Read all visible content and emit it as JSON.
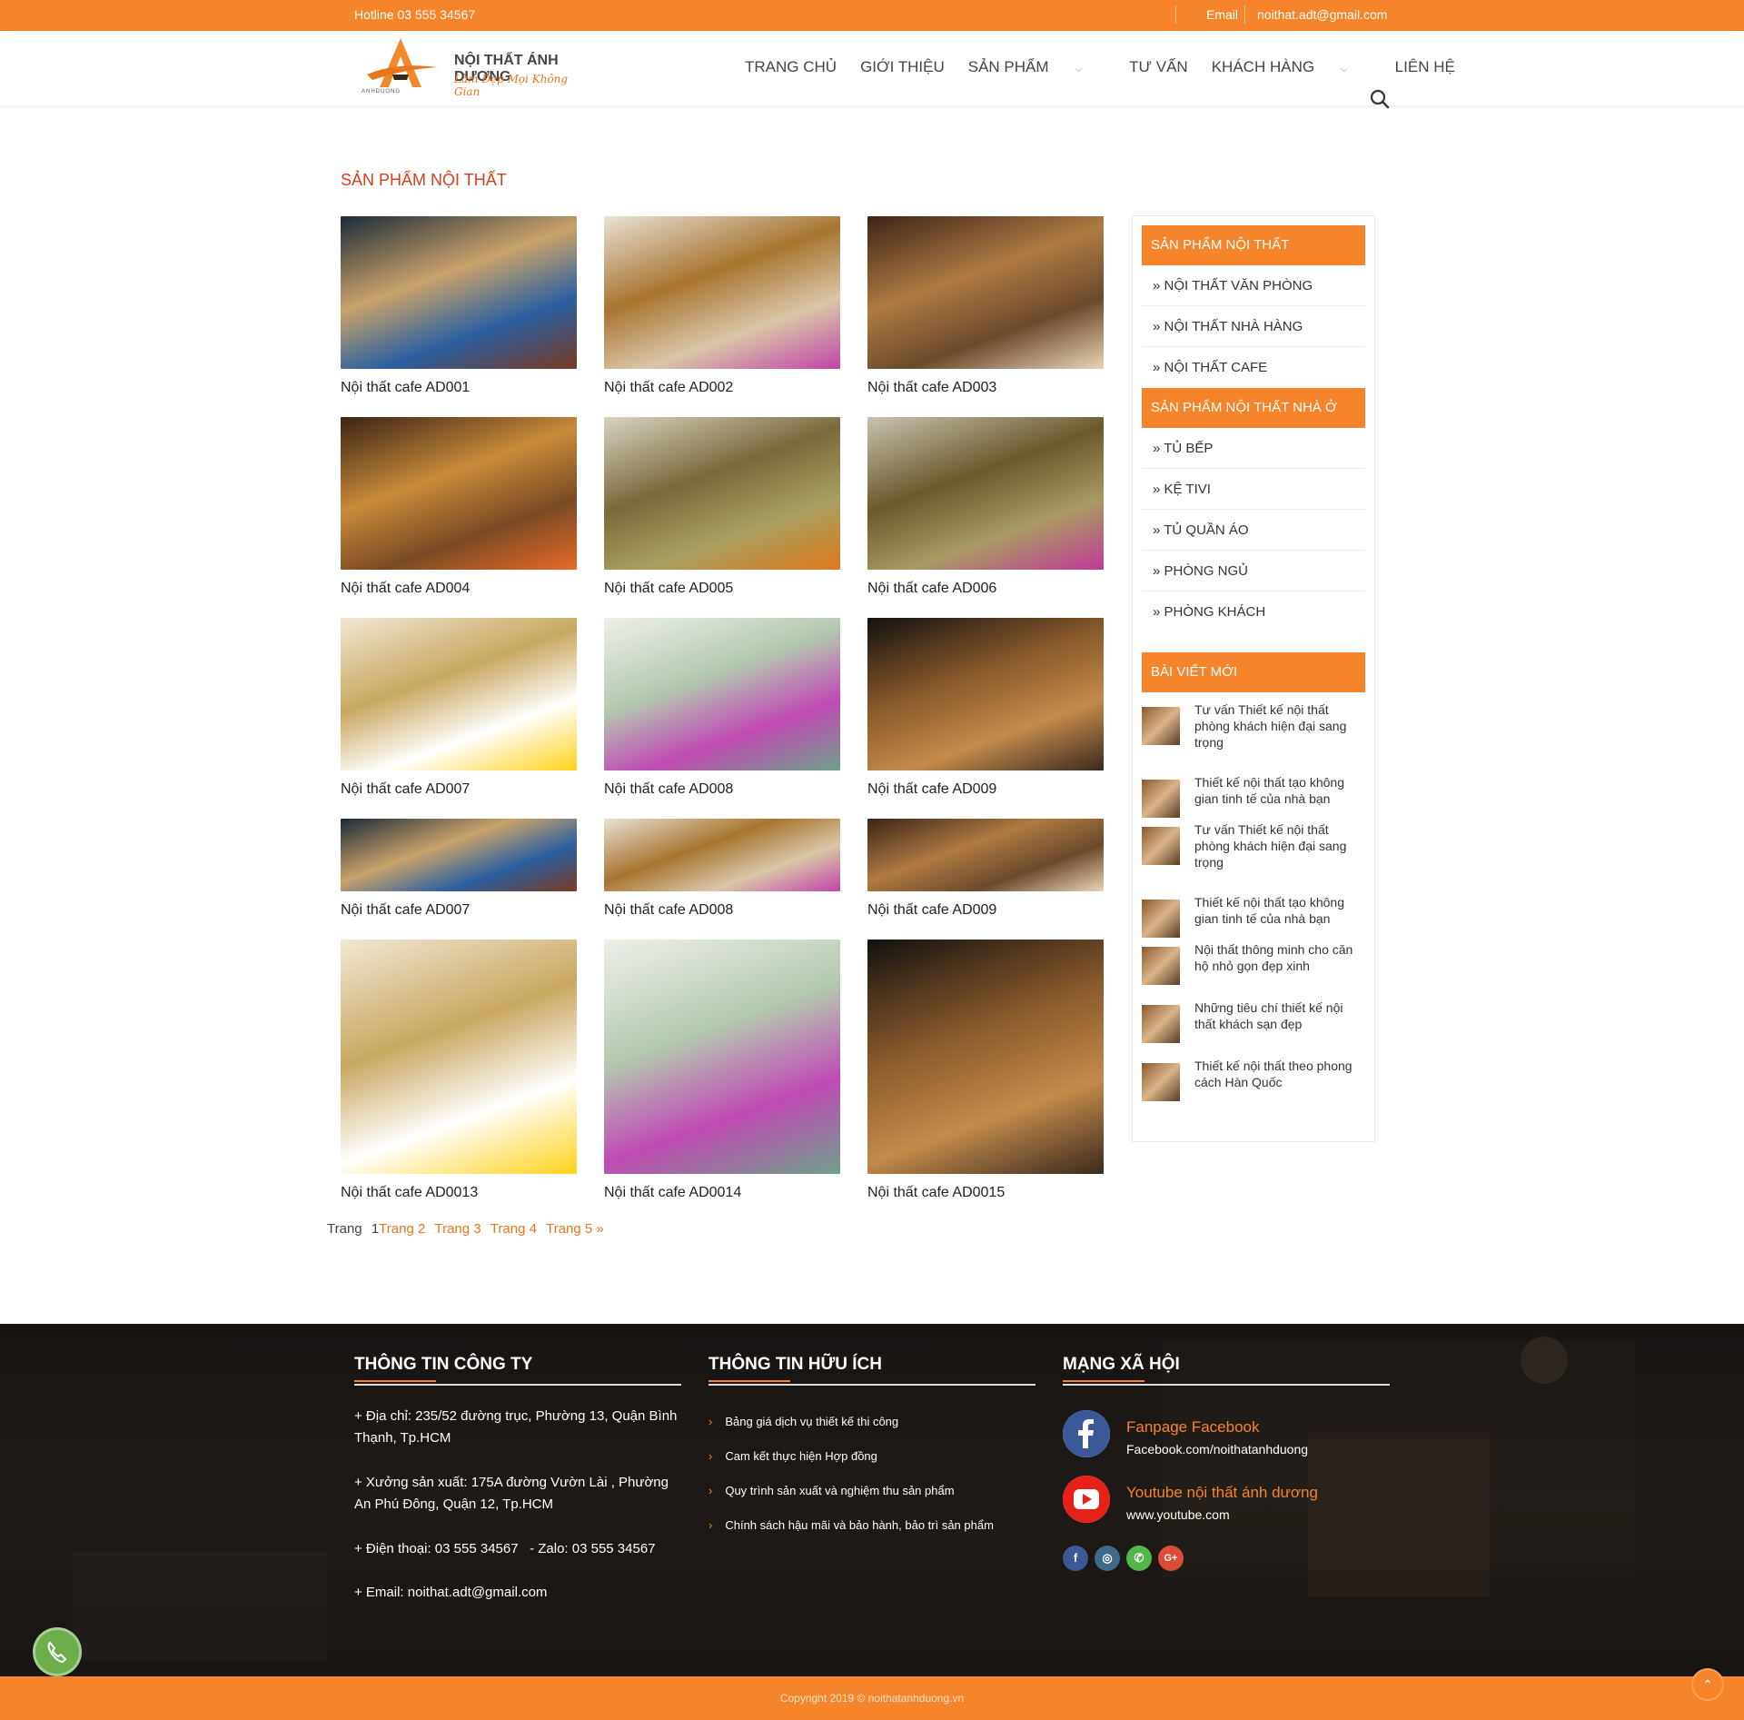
{
  "topbar": {
    "hotline": "Hotline 03 555 34567",
    "email_label": "Email",
    "email": "noithat.adt@gmail.com"
  },
  "logo": {
    "name": "NỘI THẤT ÁNH DƯƠNG",
    "tagline": "Làm Đẹp Mọi Không Gian",
    "sub": "ANHDUONG",
    "sub2": "LÀM ĐẸP MỌI KHÔNG GIAN"
  },
  "nav": {
    "items": [
      "TRANG CHỦ",
      "GIỚI THIỆU",
      "SẢN PHẨM",
      "TƯ VẤN",
      "KHÁCH HÀNG",
      "LIÊN HỆ"
    ],
    "caret": "⌵"
  },
  "page_title": "SẢN PHẨM NỘI THẤT",
  "products": [
    "Nội thất cafe AD001",
    "Nội thất cafe AD002",
    "Nội thất cafe AD003",
    "Nội thất cafe AD004",
    "Nội thất cafe AD005",
    "Nội thất cafe AD006",
    "Nội thất cafe AD007",
    "Nội thất cafe AD008",
    "Nội thất cafe AD009",
    "Nội thất cafe AD007",
    "Nội thất cafe AD008",
    "Nội thất cafe AD009",
    "Nội thất cafe AD0013",
    "Nội thất cafe AD0014",
    "Nội thất cafe AD0015"
  ],
  "pager": {
    "label": "Trang",
    "current": "1",
    "links": [
      "Trang 2",
      "Trang 3",
      "Trang 4",
      "Trang 5 »"
    ]
  },
  "sidebar": {
    "head1": "SẢN PHẨM NỘI THẤT",
    "items1": [
      "» NỘI THẤT VĂN PHÒNG",
      "» NỘI THẤT NHÀ HÀNG",
      "» NỘI THẤT CAFE"
    ],
    "head2": "SẢN PHẨM NỘI THẤT NHÀ Ở",
    "items2": [
      "» TỦ BẾP",
      "» KỆ TIVI",
      "» TỦ QUẦN ÁO",
      "» PHÒNG NGỦ",
      "» PHÒNG KHÁCH"
    ],
    "head3": "BÀI VIẾT MỚI",
    "posts": [
      "Tư vấn Thiết kế nội thất phòng khách hiện đại sang trọng",
      "Thiết kế nội thất tạo không gian tinh tế của nhà bạn",
      "Tư vấn Thiết kế nội thất phòng khách hiện đại sang trọng",
      "Thiết kế nội thất tạo không gian tinh tế của nhà bạn",
      "Nội thất thông minh cho căn hộ nhỏ gọn đẹp xinh",
      "Những tiêu chí thiết kế nội thất khách sạn đẹp",
      "Thiết kế nội thất theo phong cách Hàn Quốc"
    ]
  },
  "footer": {
    "col1": {
      "title": "THÔNG TIN CÔNG TY",
      "address": "+ Địa chỉ: 235/52 đường trục, Phường 13, Quận Bình Thạnh, Tp.HCM",
      "factory": "+ Xưởng sản xuất: 175A đường Vườn Lài , Phường An Phú Đông, Quận 12, Tp.HCM",
      "phone": "+ Điện thoại: 03 555 34567   - Zalo: 03 555 34567",
      "email": "+ Email: noithat.adt@gmail.com"
    },
    "col2": {
      "title": "THÔNG TIN HỮU ÍCH",
      "links": [
        "Bảng giá dịch vụ thiết kế thi công",
        "Cam kết thực hiện Hợp đồng",
        "Quy trình sản xuất và nghiệm thu sản phẩm",
        "Chính sách hậu mãi và bảo hành, bảo trì sản phẩm"
      ]
    },
    "col3": {
      "title": "MẠNG XÃ HỘI",
      "fb_title": "Fanpage Facebook",
      "fb_url": "Facebook.com/noithatanhduong",
      "yt_title": "Youtube nội thất ánh dương",
      "yt_url": "www.youtube.com"
    }
  },
  "copyright": "Copyright 2019 © noithatanhduong.vn",
  "colors": {
    "accent": "#f5842a",
    "title_red": "#d63f1c"
  }
}
